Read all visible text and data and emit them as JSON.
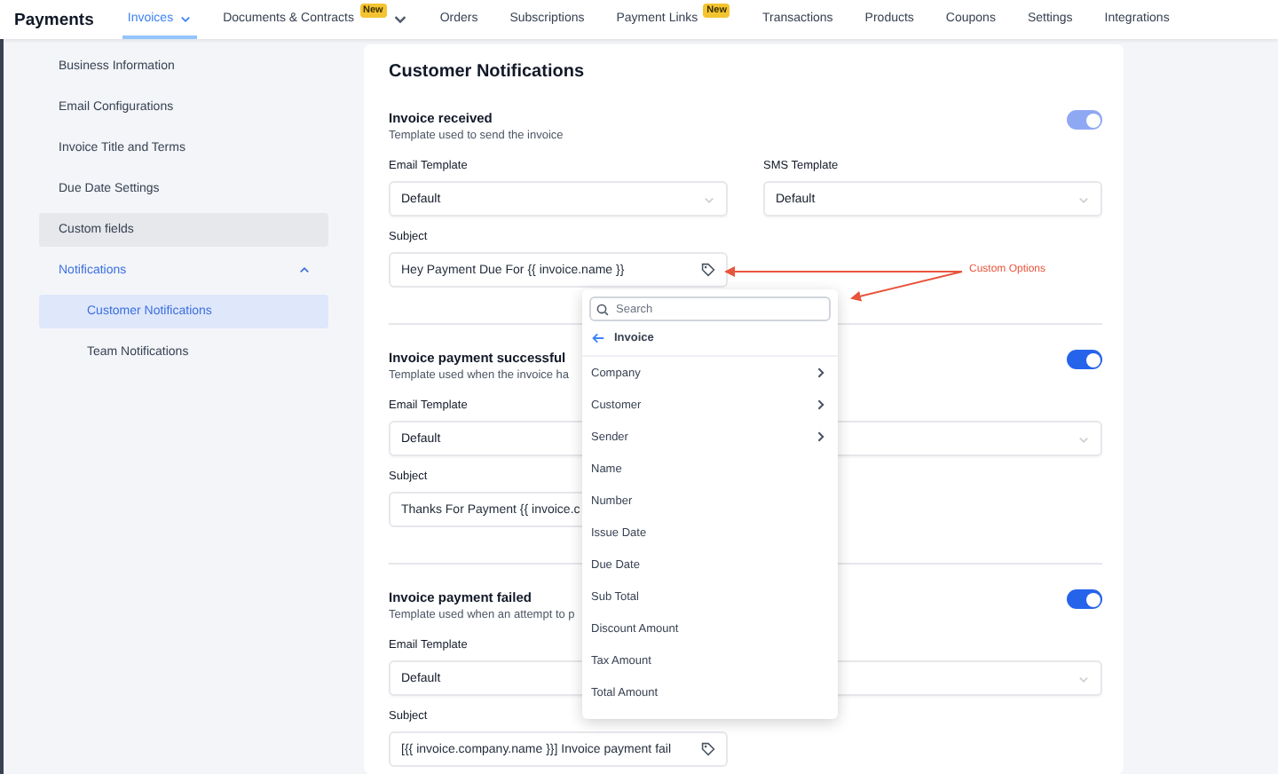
{
  "brand": "Payments",
  "nav": [
    {
      "label": "Invoices",
      "selected": true,
      "dropdown": true
    },
    {
      "label": "Documents & Contracts",
      "selected": false,
      "dropdown": true,
      "badge": "New"
    },
    {
      "label": "Orders",
      "selected": false,
      "dropdown": false
    },
    {
      "label": "Subscriptions",
      "selected": false,
      "dropdown": false
    },
    {
      "label": "Payment Links",
      "selected": false,
      "dropdown": false,
      "badge": "New"
    },
    {
      "label": "Transactions",
      "selected": false,
      "dropdown": false
    },
    {
      "label": "Products",
      "selected": false,
      "dropdown": false
    },
    {
      "label": "Coupons",
      "selected": false,
      "dropdown": false
    },
    {
      "label": "Settings",
      "selected": false,
      "dropdown": false
    },
    {
      "label": "Integrations",
      "selected": false,
      "dropdown": false
    }
  ],
  "sidebar": {
    "items": [
      {
        "label": "Business Information",
        "selected": false,
        "highlighted": false
      },
      {
        "label": "Email Configurations",
        "selected": false,
        "highlighted": false
      },
      {
        "label": "Invoice Title and Terms",
        "selected": false,
        "highlighted": false
      },
      {
        "label": "Due Date Settings",
        "selected": false,
        "highlighted": false
      },
      {
        "label": "Custom fields",
        "selected": false,
        "highlighted": true
      },
      {
        "label": "Notifications",
        "selected": true,
        "highlighted": false,
        "expanded": true,
        "children": [
          {
            "label": "Customer Notifications",
            "selected": true,
            "highlighted": false
          },
          {
            "label": "Team Notifications",
            "selected": false,
            "highlighted": false
          }
        ]
      }
    ]
  },
  "page_title": "Customer Notifications",
  "sections": [
    {
      "title": "Invoice received",
      "description": "Template used to send the invoice",
      "on": true,
      "disabled": true,
      "email_label": "Email Template",
      "email_value": "Default",
      "sms_label": "SMS Template",
      "sms_value": "Default",
      "subject_label": "Subject",
      "subject": "Hey Payment Due For {{ invoice.name }}"
    },
    {
      "title": "Invoice payment successful",
      "description": "Template used when the invoice ha",
      "on": true,
      "disabled": false,
      "email_label": "Email Template",
      "email_value": "Default",
      "subject_label": "Subject",
      "subject": "Thanks For Payment {{ invoice.c"
    },
    {
      "title": "Invoice payment failed",
      "description": "Template used when an attempt to p",
      "on": true,
      "disabled": false,
      "email_label": "Email Template",
      "email_value": "Default",
      "subject_label": "Subject",
      "subject": "[{{ invoice.company.name }}] Invoice payment fail"
    }
  ],
  "annotation": "Custom Options",
  "menu": {
    "search_placeholder": "Search",
    "back_label": "Invoice",
    "items": [
      {
        "label": "Company",
        "has_children": true
      },
      {
        "label": "Customer",
        "has_children": true
      },
      {
        "label": "Sender",
        "has_children": true
      },
      {
        "label": "Name",
        "has_children": false
      },
      {
        "label": "Number",
        "has_children": false
      },
      {
        "label": "Issue Date",
        "has_children": false
      },
      {
        "label": "Due Date",
        "has_children": false
      },
      {
        "label": "Sub Total",
        "has_children": false
      },
      {
        "label": "Discount Amount",
        "has_children": false
      },
      {
        "label": "Tax Amount",
        "has_children": false
      },
      {
        "label": "Total Amount",
        "has_children": false
      }
    ]
  }
}
